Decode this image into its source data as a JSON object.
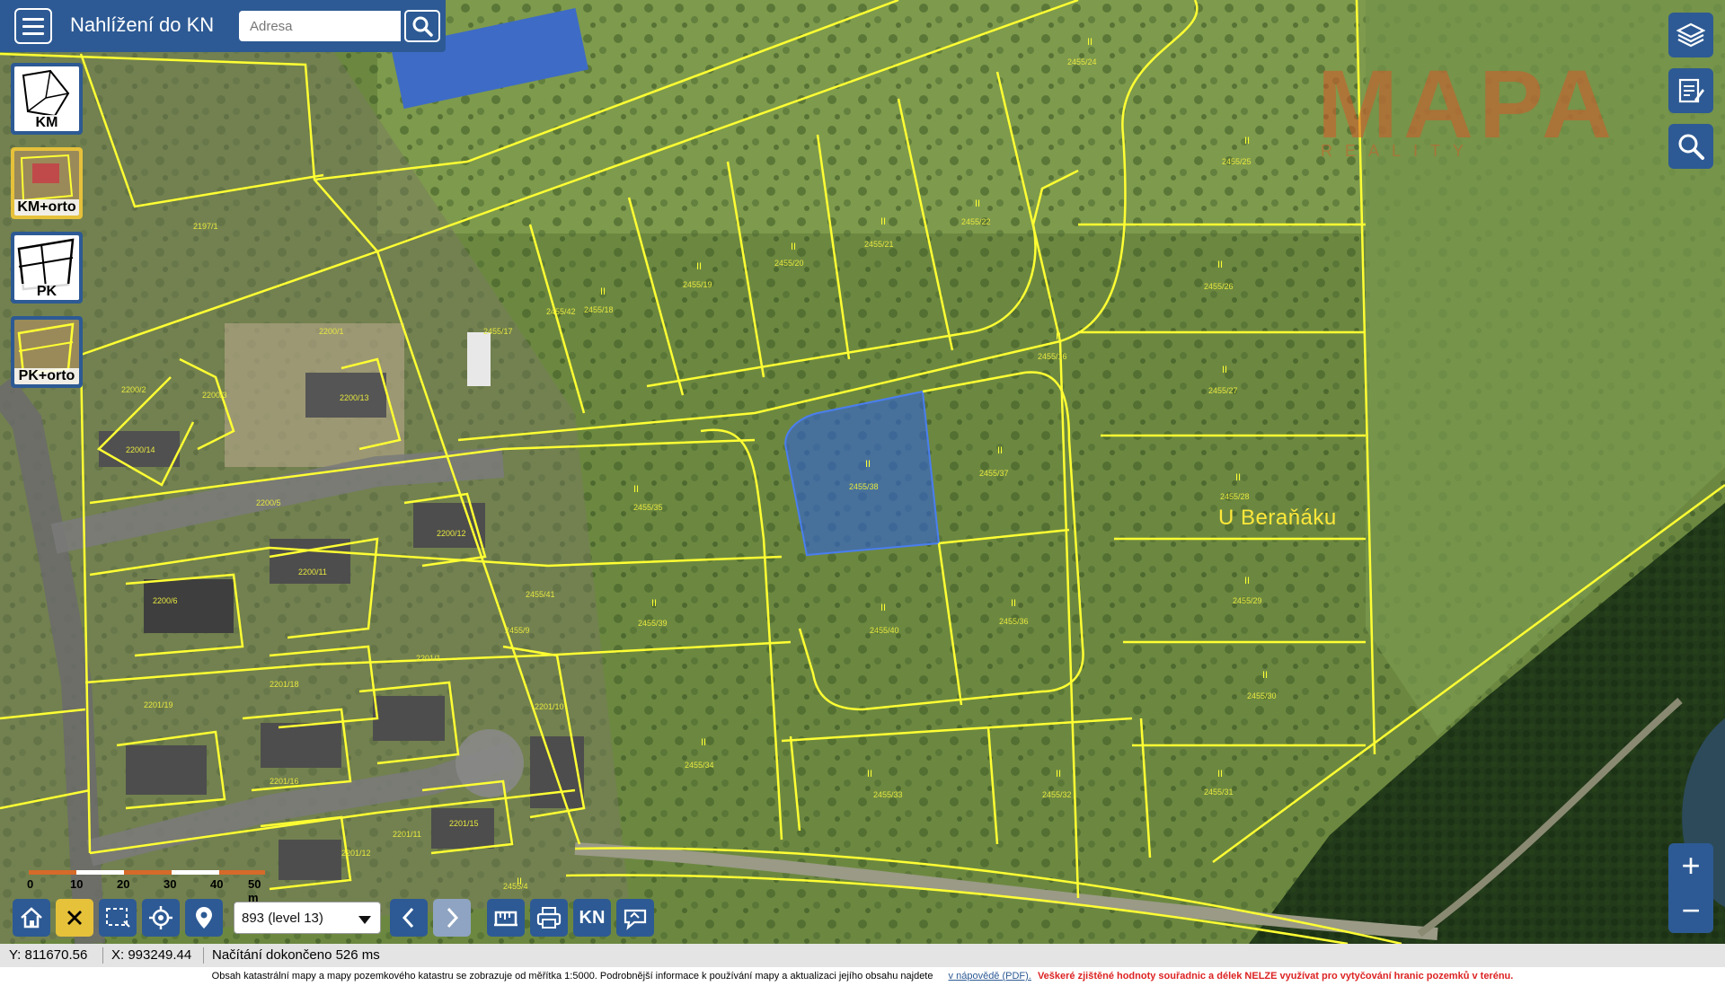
{
  "header": {
    "title": "Nahlížení do KN",
    "search_placeholder": "Adresa"
  },
  "layers": [
    {
      "id": "km",
      "label": "KM",
      "active": false
    },
    {
      "id": "km-orto",
      "label": "KM+orto",
      "active": true
    },
    {
      "id": "pk",
      "label": "PK",
      "active": false
    },
    {
      "id": "pk-orto",
      "label": "PK+orto",
      "active": false
    }
  ],
  "map": {
    "place_label": "U Beraňáku",
    "watermark": "MAPA",
    "watermark_sub": "REALITY",
    "highlight_color": "#2f62d8",
    "parcel_line_color": "#ffff33",
    "parcel_labels": [
      "2197/1",
      "2200/1",
      "2200/2",
      "2200/3",
      "2200/5",
      "2200/6",
      "2200/11",
      "2200/12",
      "2200/13",
      "2200/14",
      "2201/1",
      "2201/10",
      "2201/11",
      "2201/12",
      "2201/15",
      "2201/16",
      "2201/18",
      "2201/19",
      "2455/4",
      "2455/9",
      "2455/16",
      "2455/17",
      "2455/18",
      "2455/19",
      "2455/20",
      "2455/21",
      "2455/22",
      "2455/24",
      "2455/25",
      "2455/26",
      "2455/27",
      "2455/28",
      "2455/29",
      "2455/30",
      "2455/31",
      "2455/32",
      "2455/33",
      "2455/34",
      "2455/35",
      "2455/36",
      "2455/37",
      "2455/38",
      "2455/39",
      "2455/40",
      "2455/41",
      "2455/42"
    ]
  },
  "scale": {
    "labels": [
      "0",
      "10",
      "20",
      "30",
      "40",
      "50 m"
    ]
  },
  "toolbar": {
    "level_select": "893 (level 13)",
    "kn_label": "KN"
  },
  "status": {
    "y": "Y: 811670.56",
    "x": "X: 993249.44",
    "load": "Načítání dokončeno 526 ms"
  },
  "footer": {
    "text": "Obsah katastrální mapy a mapy pozemkového katastru se zobrazuje od měřítka 1:5000. Podrobnější informace k používání mapy a aktualizaci jejího obsahu najdete",
    "link": "v nápovědě (PDF).",
    "warning": "Veškeré zjištěné hodnoty souřadnic a délek NELZE využívat pro vytyčování hranic pozemků v terénu."
  }
}
